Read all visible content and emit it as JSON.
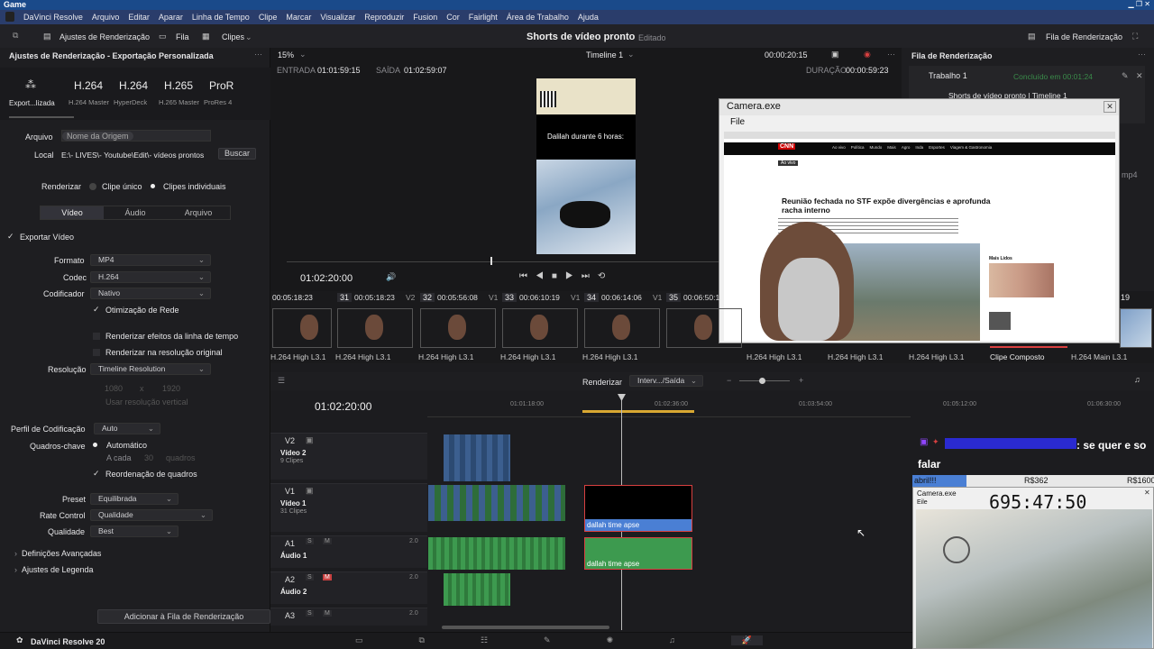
{
  "app": {
    "window_title": "Game",
    "menu": [
      "DaVinci Resolve",
      "Arquivo",
      "Editar",
      "Aparar",
      "Linha de Tempo",
      "Clipe",
      "Marcar",
      "Visualizar",
      "Reproduzir",
      "Fusion",
      "Cor",
      "Fairlight",
      "Área de Trabalho",
      "Ajuda"
    ],
    "bottom_title": "DaVinci Resolve 20"
  },
  "toolbar": {
    "render_settings": "Ajustes de Renderização",
    "queue_tab": "Fila",
    "clips_tab": "Clipes",
    "project_title": "Shorts de vídeo pronto",
    "project_status": "Editado",
    "render_queue": "Fila de Renderização"
  },
  "left": {
    "panel_title": "Ajustes de Renderização - Exportação Personalizada",
    "presets": [
      {
        "name": "H.264",
        "sub": "H.264 Master"
      },
      {
        "name": "H.264",
        "sub": "HyperDeck"
      },
      {
        "name": "H.265",
        "sub": "H.265 Master"
      },
      {
        "name": "ProR",
        "sub": "ProRes 4"
      }
    ],
    "custom_label": "Export...lizada",
    "file_label": "Arquivo",
    "file_value": "Nome da Origem",
    "location_label": "Local",
    "location_value": "E:\\- LIVES\\- Youtube\\Edit\\- vídeos prontos",
    "browse": "Buscar",
    "render_label": "Renderizar",
    "single_clip": "Clipe único",
    "individual_clips": "Clipes individuais",
    "tabs": [
      "Vídeo",
      "Áudio",
      "Arquivo"
    ],
    "export_video": "Exportar Vídeo",
    "format_label": "Formato",
    "format_value": "MP4",
    "codec_label": "Codec",
    "codec_value": "H.264",
    "encoder_label": "Codificador",
    "encoder_value": "Nativo",
    "network_opt": "Otimização de Rede",
    "render_effects": "Renderizar efeitos da linha de tempo",
    "render_original": "Renderizar na resolução original",
    "resolution_label": "Resolução",
    "resolution_value": "Timeline Resolution",
    "res_w": "1080",
    "res_x": "x",
    "res_h": "1920",
    "vertical_res": "Usar resolução vertical",
    "profile_label": "Perfil de Codificação",
    "profile_value": "Auto",
    "keyframes_label": "Quadros-chave",
    "keyframes_auto": "Automático",
    "keyframes_every": "A cada",
    "keyframes_num": "30",
    "keyframes_unit": "quadros",
    "reorder": "Reordenação de quadros",
    "preset_label": "Preset",
    "preset_value": "Equilibrada",
    "rate_label": "Rate Control",
    "rate_value": "Qualidade",
    "quality_label": "Qualidade",
    "quality_value": "Best",
    "advanced": "Definições Avançadas",
    "subtitle_settings": "Ajustes de Legenda",
    "add_queue": "Adicionar à Fila de Renderização"
  },
  "viewer": {
    "zoom": "15%",
    "timeline_name": "Timeline 1",
    "timecode_top": "00:00:20:15",
    "entrada_label": "ENTRADA",
    "entrada": "01:01:59:15",
    "saida_label": "SAÍDA",
    "saida": "01:02:59:07",
    "duracao_label": "DURAÇÃO",
    "duracao": "00:00:59:23",
    "overlay_text": "Dalilah durante 6 horas:",
    "current_tc": "01:02:20:00"
  },
  "clips": [
    {
      "num": "31",
      "tc": "00:05:18:23",
      "trk": "V2",
      "prev_tc": "00:05:18:23",
      "codec": "H.264 High L3.1"
    },
    {
      "num": "32",
      "tc": "00:05:56:08",
      "trk": "V1",
      "codec": "H.264 High L3.1"
    },
    {
      "num": "33",
      "tc": "00:06:10:19",
      "trk": "V1",
      "codec": "H.264 High L3.1"
    },
    {
      "num": "34",
      "tc": "00:06:14:06",
      "trk": "V1",
      "codec": "H.264 High L3.1"
    },
    {
      "num": "35",
      "tc": "00:06:50:1",
      "trk": "",
      "codec": "H.264 High L3.1"
    }
  ],
  "clip_codecs_right": [
    "H.264 High L3.1",
    "H.264 High L3.1",
    "H.264 High L3.1",
    "Clipe Composto",
    "H.264 Main L3.1"
  ],
  "clip_num_right": "19",
  "render": {
    "render_label": "Renderizar",
    "mode": "Interv.../Saída"
  },
  "timeline": {
    "tc": "01:02:20:00",
    "ruler": [
      "01:01:18:00",
      "01:02:36:00",
      "01:03:54:00",
      "01:05:12:00",
      "01:06:30:00"
    ],
    "tracks": [
      {
        "id": "V2",
        "name": "Vídeo 2",
        "count": "9 Clipes"
      },
      {
        "id": "V1",
        "name": "Vídeo 1",
        "count": "31 Clipes"
      },
      {
        "id": "A1",
        "name": "Áudio 1",
        "level": "2.0"
      },
      {
        "id": "A2",
        "name": "Áudio 2",
        "level": "2.0"
      },
      {
        "id": "A3",
        "name": "",
        "level": "2.0"
      }
    ],
    "clip_label": "dallah time apse",
    "s": "S",
    "m": "M"
  },
  "queue": {
    "title": "Fila de Renderização",
    "job": "Trabalho 1",
    "job_status": "Concluído em 00:01:24",
    "job_name": "Shorts de vídeo pronto | Timeline 1",
    "ext": "mp4"
  },
  "camera": {
    "title": "Camera.exe",
    "menu": "File",
    "headline": "Reunião fechada no STF expõe divergências e aprofunda racha interno",
    "brand": "CNN",
    "nav": [
      "Ao vivo",
      "Política",
      "Mundo",
      "Mais",
      "Agro",
      "Inda",
      "Esportes",
      "Viagem & Gastronomia"
    ],
    "sidebar_title": "Mais Lidos"
  },
  "chat": {
    "message": ": se quer e so falar",
    "progress_label": "abril!!!",
    "amt1": "R$362",
    "amt2": "R$1600",
    "cam_title": "Camera.exe",
    "cam_menu": "Eile",
    "clock": "695:47:50"
  },
  "colors": {
    "accent": "#4a7fd4",
    "record": "#d84040",
    "audio": "#3d9a4f",
    "queue_status": "#3a8b4a"
  }
}
